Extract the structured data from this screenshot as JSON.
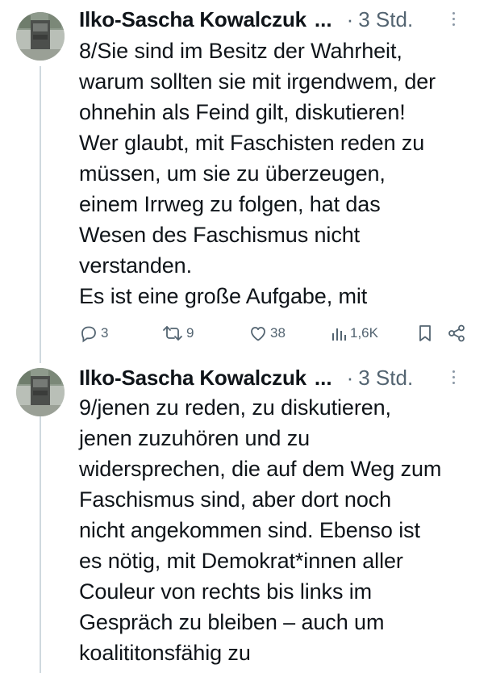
{
  "tweets": [
    {
      "author": "Ilko-Sascha Kowalczuk",
      "ellipsis": "...",
      "separator": "·",
      "time": "3 Std.",
      "text": "8/Sie sind im Besitz der Wahrheit,\nwarum sollten sie mit irgendwem, der\nohnehin als Feind gilt, diskutieren!\nWer glaubt, mit Faschisten reden zu\nmüssen, um sie zu überzeugen,\neinem Irrweg zu folgen, hat das\nWesen des Faschismus nicht\nverstanden.\nEs ist eine große Aufgabe, mit",
      "stats": {
        "replies": "3",
        "reposts": "9",
        "likes": "38",
        "views": "1,6K"
      }
    },
    {
      "author": "Ilko-Sascha Kowalczuk",
      "ellipsis": "...",
      "separator": "·",
      "time": "3 Std.",
      "text": "9/jenen zu reden, zu diskutieren,\njenen zuzuhören und zu\nwidersprechen, die auf dem Weg zum\nFaschismus sind, aber dort noch\nnicht angekommen sind. Ebenso ist\nes nötig, mit Demokrat*innen aller\nCouleur von rechts bis links im\nGespräch zu bleiben – auch um\nkoalititonsfähig zu"
    }
  ],
  "icons": {
    "reply": "reply-icon",
    "repost": "repost-icon",
    "like": "heart-icon",
    "views": "views-icon",
    "bookmark": "bookmark-icon",
    "share": "share-icon",
    "more": "more-icon"
  },
  "colors": {
    "text": "#0f1419",
    "secondary": "#536471",
    "thread_line": "#cfd9de"
  }
}
